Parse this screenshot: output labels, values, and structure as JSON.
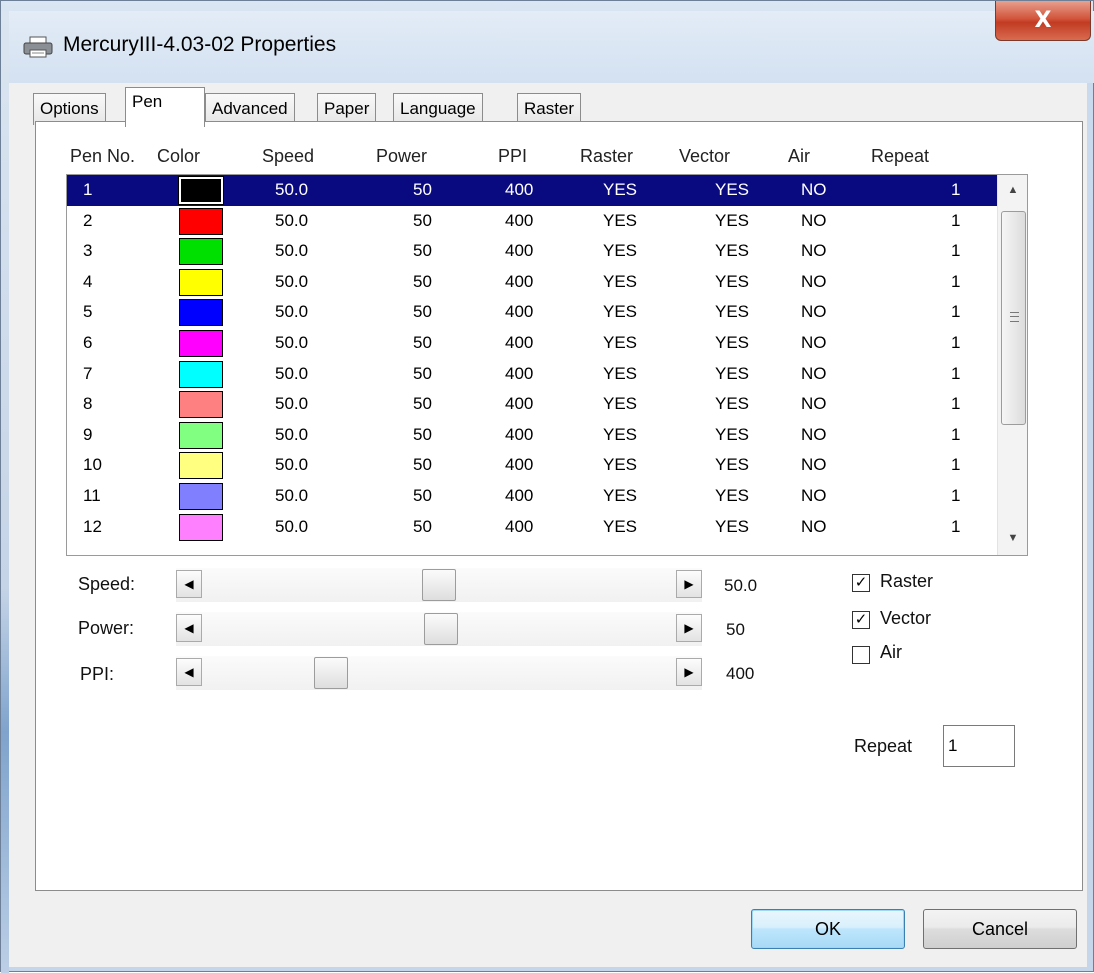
{
  "window": {
    "title": "MercuryIII-4.03-02 Properties",
    "close_glyph": "X"
  },
  "tabs": [
    "Options",
    "Pen",
    "Advanced",
    "Paper",
    "Language",
    "Raster"
  ],
  "active_tab": "Pen",
  "table": {
    "columns": [
      "Pen No.",
      "Color",
      "Speed",
      "Power",
      "PPI",
      "Raster",
      "Vector",
      "Air",
      "Repeat"
    ],
    "rows": [
      {
        "no": "1",
        "color": "#000000",
        "speed": "50.0",
        "power": "50",
        "ppi": "400",
        "raster": "YES",
        "vector": "YES",
        "air": "NO",
        "repeat": "1",
        "selected": true
      },
      {
        "no": "2",
        "color": "#ff0000",
        "speed": "50.0",
        "power": "50",
        "ppi": "400",
        "raster": "YES",
        "vector": "YES",
        "air": "NO",
        "repeat": "1"
      },
      {
        "no": "3",
        "color": "#00e000",
        "speed": "50.0",
        "power": "50",
        "ppi": "400",
        "raster": "YES",
        "vector": "YES",
        "air": "NO",
        "repeat": "1"
      },
      {
        "no": "4",
        "color": "#ffff00",
        "speed": "50.0",
        "power": "50",
        "ppi": "400",
        "raster": "YES",
        "vector": "YES",
        "air": "NO",
        "repeat": "1"
      },
      {
        "no": "5",
        "color": "#0000ff",
        "speed": "50.0",
        "power": "50",
        "ppi": "400",
        "raster": "YES",
        "vector": "YES",
        "air": "NO",
        "repeat": "1"
      },
      {
        "no": "6",
        "color": "#ff00ff",
        "speed": "50.0",
        "power": "50",
        "ppi": "400",
        "raster": "YES",
        "vector": "YES",
        "air": "NO",
        "repeat": "1"
      },
      {
        "no": "7",
        "color": "#00ffff",
        "speed": "50.0",
        "power": "50",
        "ppi": "400",
        "raster": "YES",
        "vector": "YES",
        "air": "NO",
        "repeat": "1"
      },
      {
        "no": "8",
        "color": "#ff8080",
        "speed": "50.0",
        "power": "50",
        "ppi": "400",
        "raster": "YES",
        "vector": "YES",
        "air": "NO",
        "repeat": "1"
      },
      {
        "no": "9",
        "color": "#80ff80",
        "speed": "50.0",
        "power": "50",
        "ppi": "400",
        "raster": "YES",
        "vector": "YES",
        "air": "NO",
        "repeat": "1"
      },
      {
        "no": "10",
        "color": "#ffff80",
        "speed": "50.0",
        "power": "50",
        "ppi": "400",
        "raster": "YES",
        "vector": "YES",
        "air": "NO",
        "repeat": "1"
      },
      {
        "no": "11",
        "color": "#8080ff",
        "speed": "50.0",
        "power": "50",
        "ppi": "400",
        "raster": "YES",
        "vector": "YES",
        "air": "NO",
        "repeat": "1"
      },
      {
        "no": "12",
        "color": "#ff80ff",
        "speed": "50.0",
        "power": "50",
        "ppi": "400",
        "raster": "YES",
        "vector": "YES",
        "air": "NO",
        "repeat": "1"
      }
    ]
  },
  "sliders": {
    "speed": {
      "label": "Speed:",
      "value": "50.0"
    },
    "power": {
      "label": "Power:",
      "value": "50"
    },
    "ppi": {
      "label": "PPI:",
      "value": "400"
    }
  },
  "checkboxes": {
    "raster": {
      "label": "Raster",
      "checked": true
    },
    "vector": {
      "label": "Vector",
      "checked": true
    },
    "air": {
      "label": "Air",
      "checked": false
    }
  },
  "repeat": {
    "label": "Repeat",
    "value": "1"
  },
  "buttons": {
    "ok": "OK",
    "cancel": "Cancel"
  },
  "colors": {
    "selection": "#0a0a80",
    "title_bg": "#dbe6f3",
    "close": "#c13b22"
  }
}
